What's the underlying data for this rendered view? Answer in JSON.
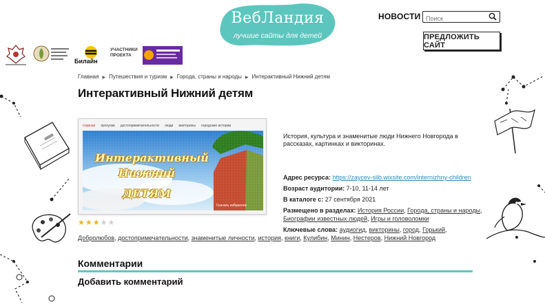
{
  "logo": {
    "title": "ВебЛандия",
    "subtitle": "лучшие сайты для детей",
    "color": "#5cc6be"
  },
  "nav": {
    "news": "НОВОСТИ"
  },
  "search": {
    "placeholder": "Поиск",
    "icon": "search-icon"
  },
  "suggest_button": "ПРЕДЛОЖИТЬ САЙТ",
  "partners": [
    {
      "name": "ministry-logo"
    },
    {
      "name": "children-library-logo"
    },
    {
      "name": "beeline-logo",
      "text": "Билайн"
    },
    {
      "name": "participants-label",
      "text": "УЧАСТНИКИ ПРОЕКТА"
    },
    {
      "name": "award-logo"
    }
  ],
  "breadcrumb": [
    "Главная",
    "Путешествия и туризм",
    "Города, страны и народы",
    "Интерактивный Нижний детям"
  ],
  "page_title": "Интерактивный Нижний детям",
  "preview": {
    "nav": [
      "главная",
      "прогулки",
      "достопримечательности",
      "люди",
      "викторины",
      "городские истории"
    ],
    "lines": [
      "Интерактивный",
      "Нижний",
      "ДЕТЯМ"
    ],
    "caption": "Скачать избранное"
  },
  "rating": {
    "value": 3,
    "max": 5,
    "filled_color": "#e8b820",
    "empty_color": "#cfcfcf"
  },
  "description": "История, культура и знаменитые люди Нижнего Новгорода в рассказах, картинках и викторинах.",
  "info": {
    "address_label": "Адрес ресурса:",
    "address_value": "https://zaycev-slib.wixsite.com/internizhny-children",
    "age_label": "Возраст аудитории:",
    "age_value": "7-10, 11-14 лет",
    "catalog_label": "В каталоге с:",
    "catalog_value": "27 сентября 2021",
    "sections_label": "Размещено в разделах:",
    "sections": [
      "История России",
      "Города, страны и народы",
      "Биографии известных людей",
      "Игры и головоломки"
    ],
    "keywords_label": "Ключевые слова:",
    "keywords": [
      "аудиогид",
      "викторины",
      "город",
      "Горький",
      "Добролюбов",
      "достопримечательности",
      "знаменитые личности",
      "история",
      "книги",
      "Кулибин",
      "Минин",
      "Нестеров",
      "Нижний Новгород"
    ]
  },
  "comments": {
    "heading": "Комментарии",
    "add": "Добавить комментарий",
    "accent": "#5ec8c0"
  }
}
